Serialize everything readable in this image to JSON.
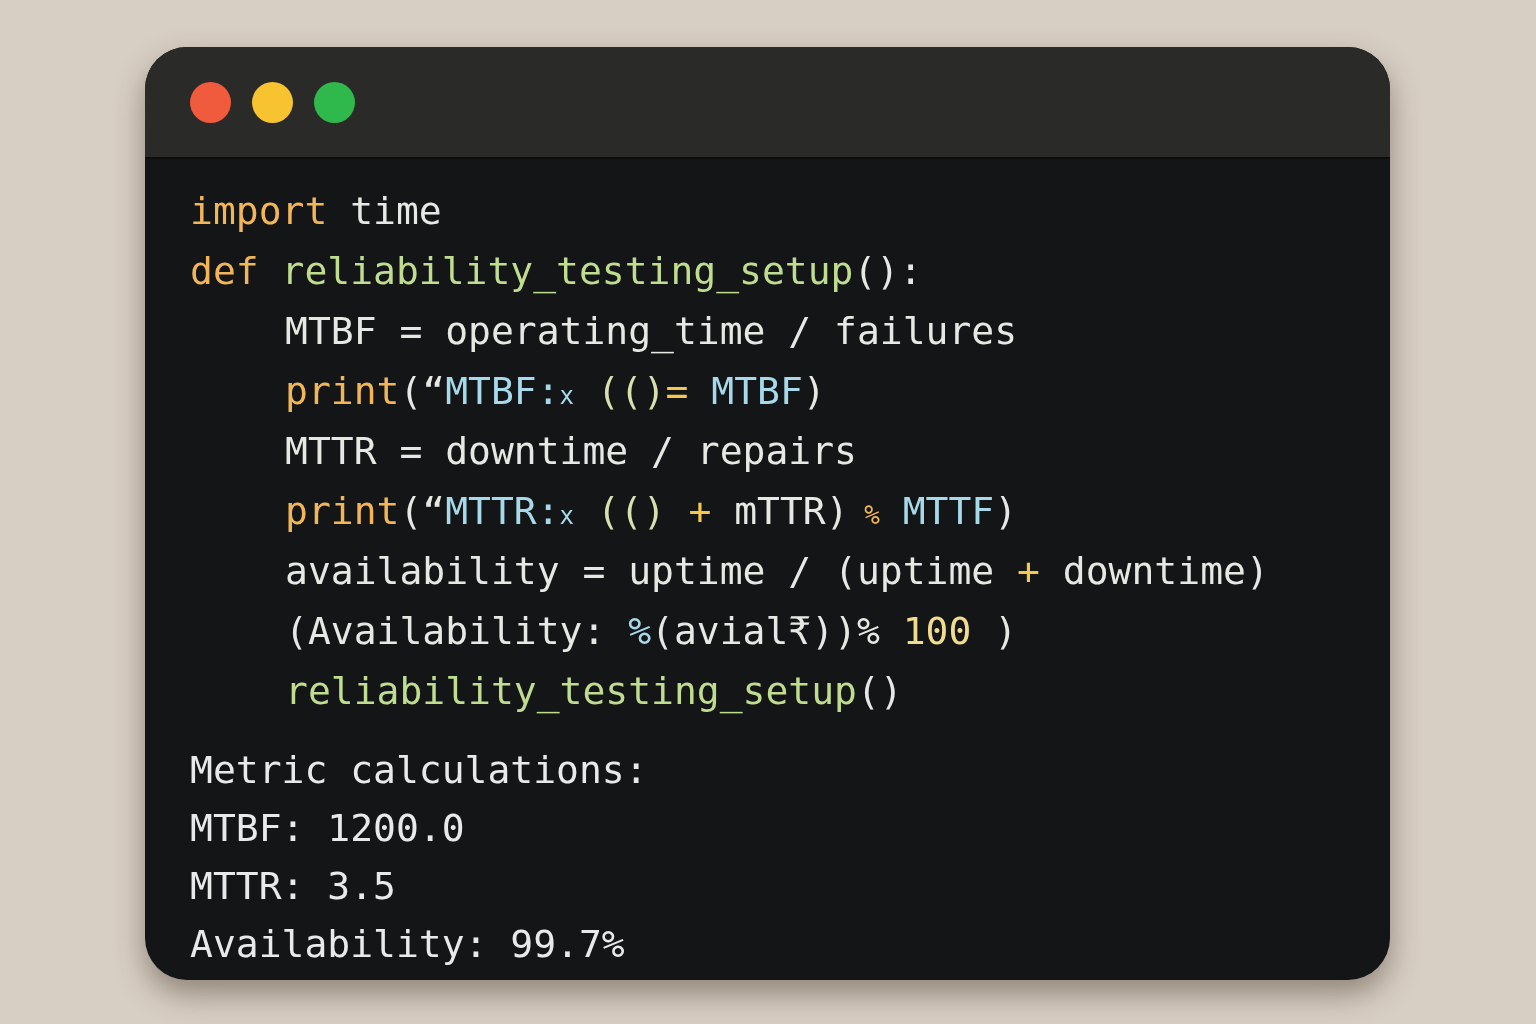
{
  "window": {
    "controls": [
      {
        "color": "#f05a3d"
      },
      {
        "color": "#f7c331"
      },
      {
        "color": "#2fb94c"
      }
    ]
  },
  "code": [
    {
      "tokens": [
        {
          "text": "import",
          "kind": "keyword"
        },
        {
          "text": " time",
          "kind": "plain"
        }
      ]
    },
    {
      "tokens": [
        {
          "text": "def",
          "kind": "keyword"
        },
        {
          "text": " reliability_testing_setup",
          "kind": "function"
        },
        {
          "text": "():",
          "kind": "plain"
        }
      ],
      "children": [
        {
          "tokens": [
            {
              "text": "MTBF = operating_time / failures",
              "kind": "plain"
            }
          ]
        },
        {
          "tokens": [
            {
              "text": "print",
              "kind": "keyword"
            },
            {
              "text": "(“",
              "kind": "plain"
            },
            {
              "text": "MTBF:",
              "kind": "string"
            },
            {
              "text": "x",
              "kind": "small"
            },
            {
              "text": " (()",
              "kind": "paren"
            },
            {
              "text": "=",
              "kind": "operator"
            },
            {
              "text": " MTBF",
              "kind": "string"
            },
            {
              "text": ")",
              "kind": "plain"
            }
          ]
        },
        {
          "tokens": [
            {
              "text": "MTTR = downtime / repairs",
              "kind": "plain"
            }
          ]
        },
        {
          "tokens": [
            {
              "text": "print",
              "kind": "keyword"
            },
            {
              "text": "(“",
              "kind": "plain"
            },
            {
              "text": "MTTR:",
              "kind": "string"
            },
            {
              "text": "x",
              "kind": "small"
            },
            {
              "text": " (()",
              "kind": "paren"
            },
            {
              "text": " + ",
              "kind": "operator"
            },
            {
              "text": "mTTR)",
              "kind": "plain"
            },
            {
              "text": " %",
              "kind": "small-op"
            },
            {
              "text": " MTTF",
              "kind": "string"
            },
            {
              "text": ")",
              "kind": "plain"
            }
          ]
        },
        {
          "tokens": [
            {
              "text": "availability = uptime / (uptime ",
              "kind": "plain"
            },
            {
              "text": "+",
              "kind": "operator"
            },
            {
              "text": " downtime)",
              "kind": "plain"
            }
          ]
        },
        {
          "tokens": [
            {
              "text": "(Availability: ",
              "kind": "plain"
            },
            {
              "text": "%",
              "kind": "string"
            },
            {
              "text": "(avial₹))%",
              "kind": "plain"
            },
            {
              "text": " 100",
              "kind": "number"
            },
            {
              "text": " )",
              "kind": "plain"
            }
          ]
        },
        {
          "tokens": [
            {
              "text": "reliability_testing_setup",
              "kind": "function"
            },
            {
              "text": "()",
              "kind": "plain"
            }
          ]
        }
      ]
    }
  ],
  "output": [
    "Metric calculations:",
    "MTBF: 1200.0",
    "MTTR: 3.5",
    "Availability: 99.7%"
  ]
}
